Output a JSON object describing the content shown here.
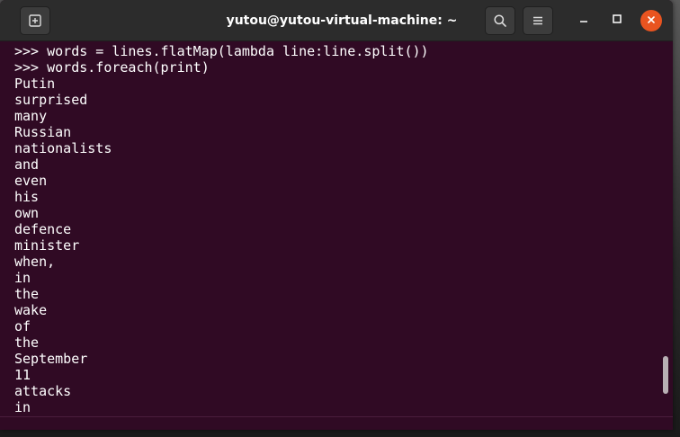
{
  "window": {
    "title": "yutou@yutou-virtual-machine: ~"
  },
  "titlebar": {
    "new_tab_icon": "new-tab-icon",
    "search_icon": "search-icon",
    "menu_icon": "hamburger-menu-icon",
    "minimize_icon": "minimize-icon",
    "maximize_icon": "maximize-icon",
    "close_icon": "close-icon"
  },
  "colors": {
    "terminal_bg": "#300a24",
    "titlebar_bg": "#2c2c2c",
    "close_accent": "#e95420",
    "text": "#ffffff"
  },
  "terminal": {
    "lines": [
      ">>> words = lines.flatMap(lambda line:line.split())",
      ">>> words.foreach(print)",
      "Putin",
      "surprised",
      "many",
      "Russian",
      "nationalists",
      "and",
      "even",
      "his",
      "own",
      "defence",
      "minister",
      "when,",
      "in",
      "the",
      "wake",
      "of",
      "the",
      "September",
      "11",
      "attacks",
      "in"
    ]
  }
}
